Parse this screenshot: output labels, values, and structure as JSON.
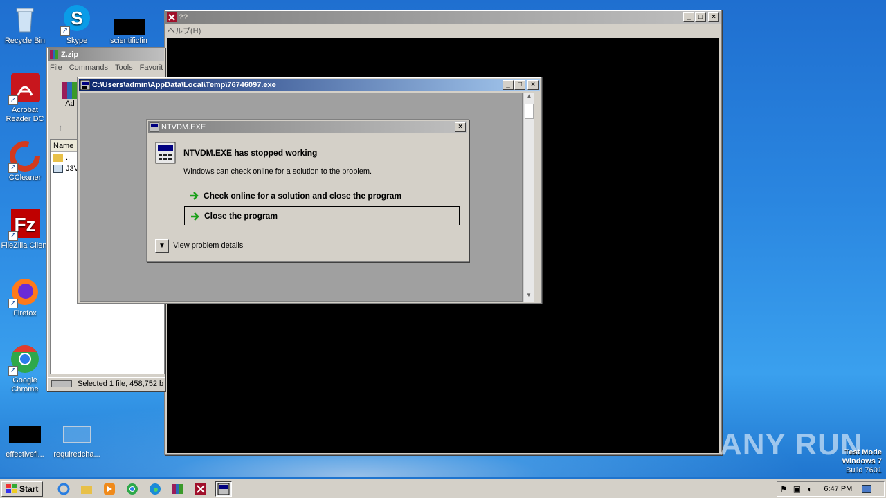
{
  "desktop": {
    "icons": [
      {
        "label": "Recycle Bin"
      },
      {
        "label": "Skype"
      },
      {
        "label": "scientificfin"
      },
      {
        "label": "Acrobat Reader DC"
      },
      {
        "label": "CCleaner"
      },
      {
        "label": "FileZilla Client"
      },
      {
        "label": "Firefox"
      },
      {
        "label": "Google Chrome"
      },
      {
        "label": "effectivefl..."
      },
      {
        "label": "requiredcha..."
      }
    ],
    "watermark": {
      "brand": "ANY RUN",
      "line1": "Test Mode",
      "line2": "Windows 7",
      "line3": "Build 7601"
    }
  },
  "console_window": {
    "title": "??",
    "menu": [
      "ヘルプ(H)"
    ]
  },
  "winrar_window": {
    "title": "Z.zip",
    "menu": [
      "File",
      "Commands",
      "Tools",
      "Favorit"
    ],
    "toolbar_label": "Ad",
    "column_name": "Name",
    "rows": [
      "..",
      "J3V"
    ],
    "status": "Selected 1 file, 458,752 b"
  },
  "cmd_window": {
    "title": "C:\\Users\\admin\\AppData\\Local\\Temp\\76746097.exe"
  },
  "error_dialog": {
    "title": "NTVDM.EXE",
    "heading": "NTVDM.EXE has stopped working",
    "subtext": "Windows can check online for a solution to the problem.",
    "option_check": "Check online for a solution and close the program",
    "option_close": "Close the program",
    "details": "View problem details"
  },
  "taskbar": {
    "start": "Start",
    "clock": "6:47 PM"
  },
  "colors": {
    "active_title": "#0a246a",
    "dialog_bg": "#d4d0c8",
    "console_bg": "#000000",
    "green_arrow": "#1aa01a"
  }
}
